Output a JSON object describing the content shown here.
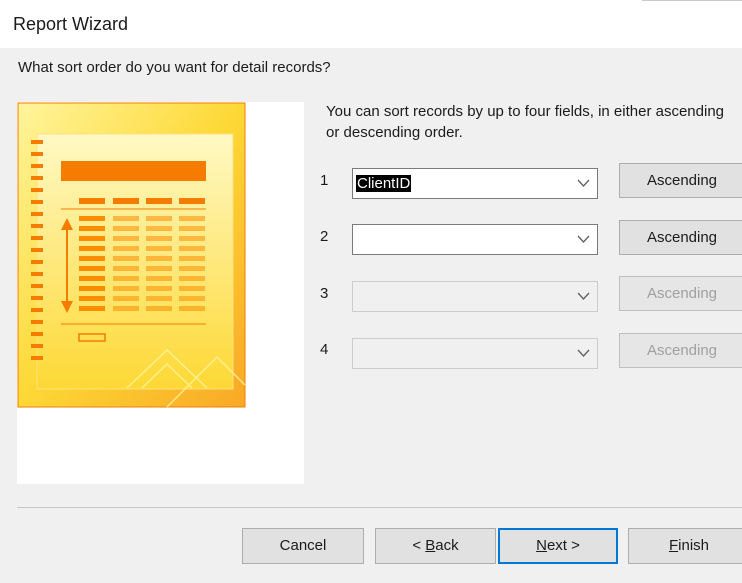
{
  "window": {
    "title": "Report Wizard"
  },
  "prompt": {
    "question": "What sort order do you want for detail records?",
    "description": "You can sort records by up to four fields, in either ascending or descending order."
  },
  "sort_fields": [
    {
      "number": "1",
      "value": "ClientID",
      "order": "Ascending",
      "enabled": true,
      "selected": true
    },
    {
      "number": "2",
      "value": "",
      "order": "Ascending",
      "enabled": true,
      "selected": false
    },
    {
      "number": "3",
      "value": "",
      "order": "Ascending",
      "enabled": false,
      "selected": false
    },
    {
      "number": "4",
      "value": "",
      "order": "Ascending",
      "enabled": false,
      "selected": false
    }
  ],
  "footer": {
    "cancel_label": "Cancel",
    "back_label": "< Back",
    "back_mnemonic": "B",
    "next_label": "Next >",
    "next_mnemonic": "N",
    "finish_label": "Finish",
    "finish_mnemonic": "F"
  },
  "colors": {
    "accent": "#0078d7",
    "art_gold": "#fbc02d",
    "art_orange": "#f57c00"
  },
  "icons": {
    "combo_arrow": "chevron-down-icon",
    "illustration": "report-preview-illustration"
  }
}
